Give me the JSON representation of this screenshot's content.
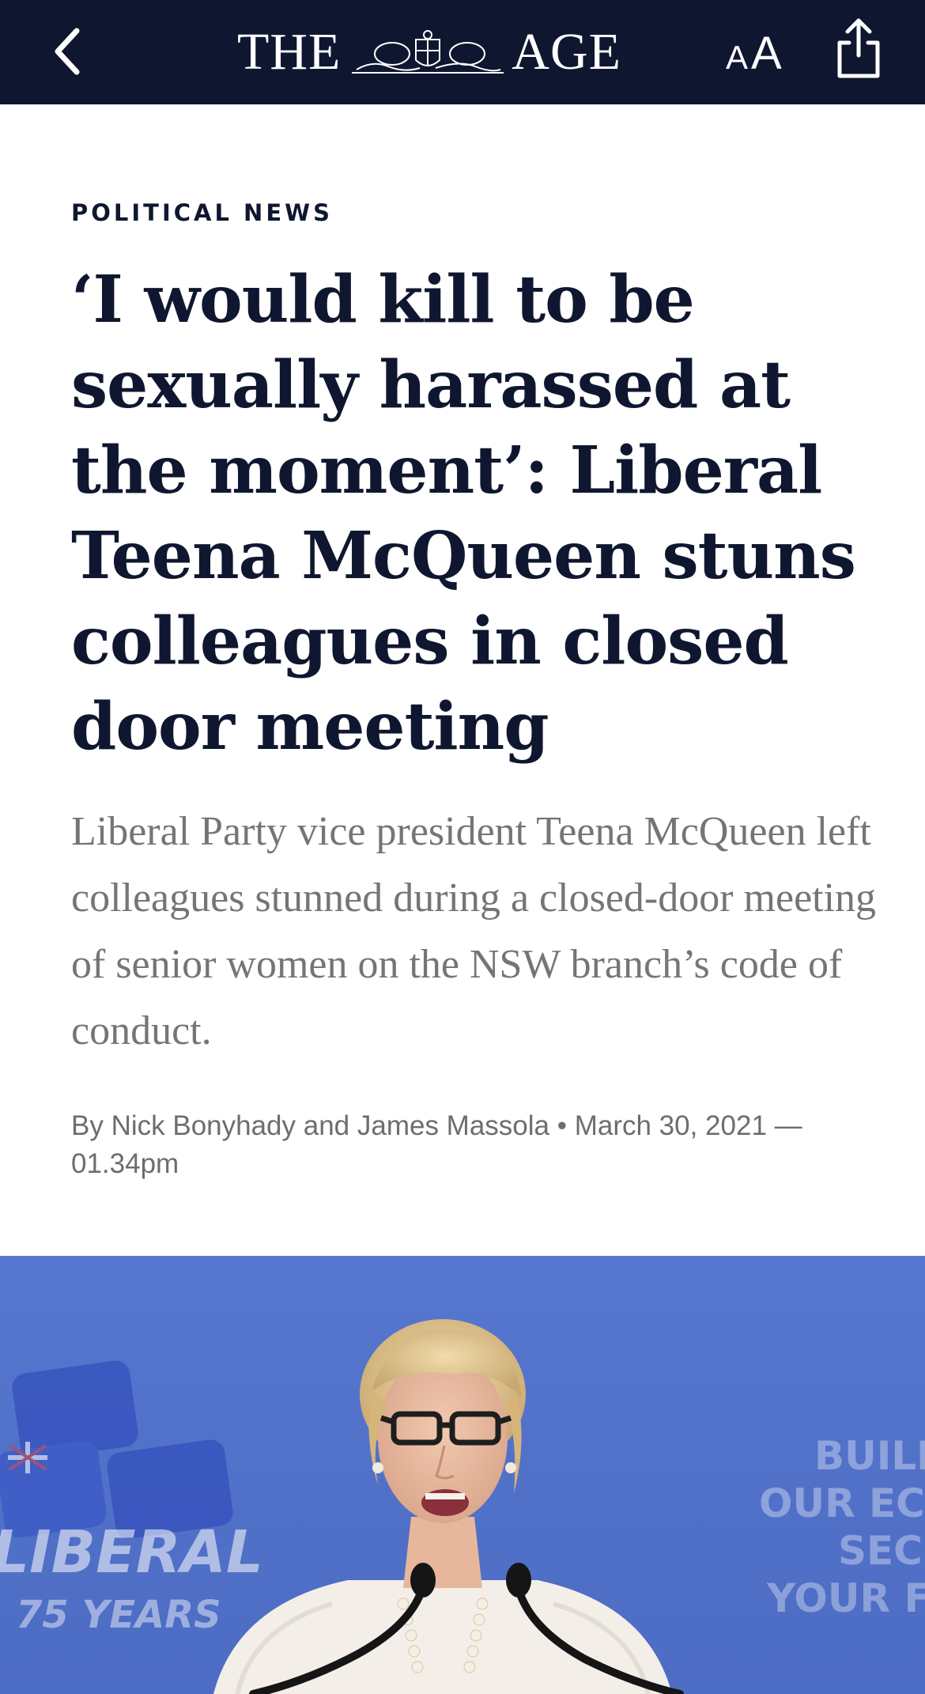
{
  "header": {
    "back_icon": "chevron-left-icon",
    "logo_left": "THE",
    "logo_right": "AGE",
    "text_size_small": "A",
    "text_size_large": "A",
    "share_icon": "share-icon",
    "background_color": "#0f1730"
  },
  "article": {
    "kicker": "POLITICAL NEWS",
    "headline": "‘I would kill to be sexually harassed at the moment’: Liberal Teena McQueen stuns colleagues in closed door meeting",
    "standfirst": "Liberal Party vice president Teena McQueen left colleagues stunned during a closed-door meeting of senior women on the NSW branch’s code of conduct.",
    "byline": "By Nick Bonyhady and James Massola • March 30, 2021 — 01.34pm"
  },
  "hero_image": {
    "backdrop_text_1": "LIBERAL",
    "backdrop_text_2": "75 YEARS",
    "backdrop_text_3": "BUILD",
    "backdrop_text_4": "OUR ECO",
    "backdrop_text_5": "SECURE",
    "backdrop_text_6": "YOUR FU",
    "background_color": "#5a78cc"
  }
}
